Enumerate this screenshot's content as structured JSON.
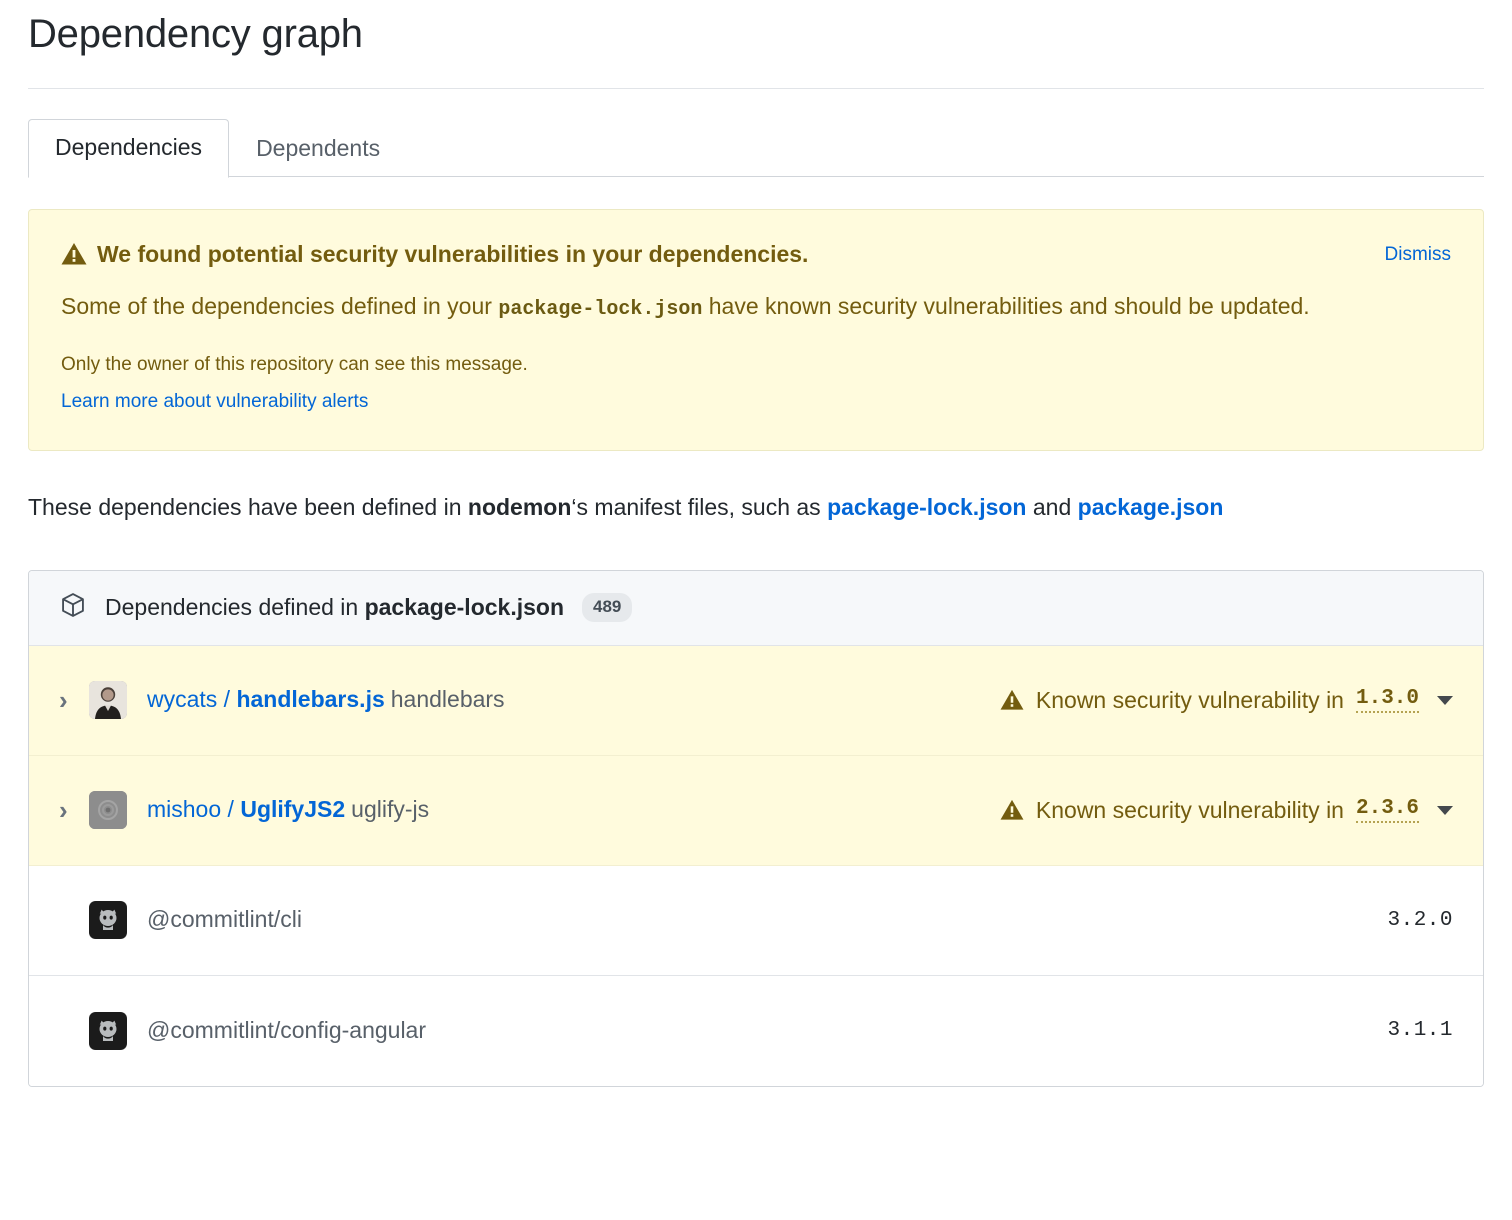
{
  "page": {
    "title": "Dependency graph"
  },
  "tabs": [
    {
      "label": "Dependencies",
      "active": true
    },
    {
      "label": "Dependents",
      "active": false
    }
  ],
  "banner": {
    "icon": "alert-icon",
    "heading": "We found potential security vulnerabilities in your dependencies.",
    "body_part1": "Some of the dependencies defined in your ",
    "body_code": "package-lock.json",
    "body_part2": " have known security vulnerabilities and should be updated.",
    "note": "Only the owner of this repository can see this message.",
    "learn_more": "Learn more about vulnerability alerts",
    "dismiss": "Dismiss",
    "bg_color": "#fffbdd",
    "border_color": "#ece9c3",
    "text_color": "#735c0f",
    "link_color": "#0366d6"
  },
  "intro": {
    "part1": "These dependencies have been defined in ",
    "repo": "nodemon",
    "part2": "‘s manifest files, such as ",
    "link1": "package-lock.json",
    "part3": " and ",
    "link2": "package.json"
  },
  "dep_box": {
    "icon": "package-icon",
    "header_prefix": "Dependencies defined in ",
    "header_file": "package-lock.json",
    "count": "489",
    "rows": [
      {
        "expandable": true,
        "chevron": "chevron-right-icon",
        "avatar": "avatar-wycats",
        "owner": "wycats",
        "separator": "/",
        "repo": "handlebars.js",
        "package": "handlebars",
        "vulnerable": true,
        "alert_icon": "alert-icon",
        "status_text": "Known security vulnerability in",
        "version": "1.3.0",
        "has_caret": true
      },
      {
        "expandable": true,
        "chevron": "chevron-right-icon",
        "avatar": "avatar-mishoo",
        "owner": "mishoo",
        "separator": "/",
        "repo": "UglifyJS2",
        "package": "uglify-js",
        "vulnerable": true,
        "alert_icon": "alert-icon",
        "status_text": "Known security vulnerability in",
        "version": "2.3.6",
        "has_caret": true
      },
      {
        "expandable": false,
        "avatar": "avatar-npm-commitlint",
        "plain_name": "@commitlint/cli",
        "vulnerable": false,
        "version": "3.2.0",
        "has_caret": false
      },
      {
        "expandable": false,
        "avatar": "avatar-npm-commitlint",
        "plain_name": "@commitlint/config-angular",
        "vulnerable": false,
        "version": "3.1.1",
        "has_caret": false
      }
    ]
  }
}
